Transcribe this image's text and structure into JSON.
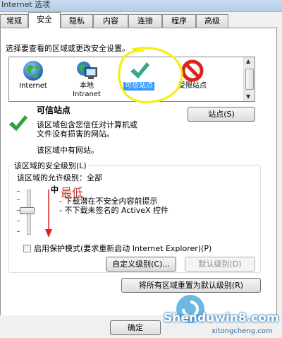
{
  "window": {
    "title": "Internet 选项"
  },
  "tabs": [
    {
      "label": "常规"
    },
    {
      "label": "安全"
    },
    {
      "label": "隐私"
    },
    {
      "label": "内容"
    },
    {
      "label": "连接"
    },
    {
      "label": "程序"
    },
    {
      "label": "高级"
    }
  ],
  "security": {
    "instruction": "选择要查看的区域或更改安全设置。",
    "zones": [
      {
        "label": "Internet",
        "icon": "globe-icon"
      },
      {
        "label_line1": "本地",
        "label_line2": "Intranet",
        "icon": "intranet-computer-icon"
      },
      {
        "label": "可信站点",
        "icon": "green-check-icon",
        "selected": true
      },
      {
        "label": "受限站点",
        "icon": "restricted-no-entry-icon"
      }
    ],
    "zone_title": "可信站点",
    "zone_desc_line1": "该区域包含您信任对计算机或",
    "zone_desc_line2": "文件没有损害的网站。",
    "zone_sites_note": "该区域中有网站。",
    "sites_button": "站点(S)",
    "level_group": {
      "title": "该区域的安全级别(L)",
      "allowed_levels": "该区域的允许级别：全部",
      "current_level": "中",
      "bullet1": "- 下载潜在不安全内容前提示",
      "bullet2": "- 不下载未签名的 ActiveX 控件",
      "protected_mode": "启用保护模式(要求重新启动 Internet Explorer)(P)",
      "custom_level_button": "自定义级别(C)...",
      "default_level_button": "默认级别(D)"
    },
    "reset_all_button": "将所有区域重置为默认级别(R)",
    "annotation_text": "最低"
  },
  "footer": {
    "ok_button": "确定"
  },
  "watermark": {
    "brand": "Shenduwin8.com",
    "sub": "xitongcheng.com"
  }
}
